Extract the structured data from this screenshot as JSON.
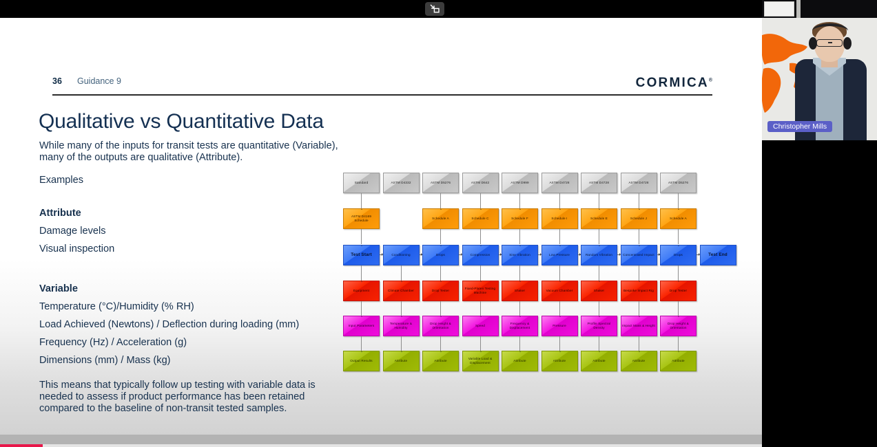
{
  "window": {
    "fullscreen_toggle_icon": "exit-fullscreen-icon"
  },
  "slide": {
    "page_number": "36",
    "section_label": "Guidance 9",
    "brand": "CORMICA",
    "brand_mark": "®",
    "title": "Qualitative vs Quantitative Data",
    "intro": "While many of the inputs for transit tests are quantitative (Variable), many of the outputs are qualitative (Attribute).",
    "examples_label": "Examples",
    "attribute_heading": "Attribute",
    "attribute_items": [
      "Damage levels",
      "Visual inspection"
    ],
    "variable_heading": "Variable",
    "variable_items": [
      "Temperature (°C)/Humidity (% RH)",
      "Load Achieved (Newtons) / Deflection during loading (mm)",
      "Frequency (Hz) / Acceleration (g)",
      "Dimensions (mm) / Mass (kg)"
    ],
    "closing": "This means that typically follow up testing with variable data is needed to assess if product performance has been retained compared to the baseline of non-transit tested samples."
  },
  "diagram": {
    "rows": [
      {
        "name": "standard-row",
        "color": "#c9c9c9",
        "cells": [
          "Standard",
          "ASTM D4332",
          "ASTM D5276",
          "ASTM D642",
          "ASTM D999",
          "ASTM D4728",
          "ASTM D4728",
          "ASTM D4728",
          "ASTM D5276",
          ""
        ]
      },
      {
        "name": "schedule-row",
        "color": "#ff9c0a",
        "cells": [
          "ASTM D4169 Schedule",
          "",
          "Schedule A",
          "Schedule C",
          "Schedule F",
          "Schedule I",
          "Schedule E",
          "Schedule J",
          "Schedule A",
          ""
        ]
      },
      {
        "name": "test-sequence-row",
        "color": "#2f6cf2",
        "cells": [
          "Test Start",
          "Conditioning",
          "Drops",
          "Compression",
          "Sine Vibration",
          "Low Pressure",
          "Random Vibration",
          "Concentrated Impact",
          "Drops",
          "Test End"
        ]
      },
      {
        "name": "equipment-row",
        "color": "#f72200",
        "cells": [
          "Equipment",
          "Climate Chamber",
          "Drop Tester",
          "Fixed-Platen Testing Machine",
          "Shaker",
          "Vacuum Chamber",
          "Shaker",
          "Bespoke Impact Rig",
          "Drop Tester",
          ""
        ]
      },
      {
        "name": "input-parameters-row",
        "color": "#ef0edc",
        "cells": [
          "Input Parameters",
          "Temperature & Humidity",
          "Drop Height & Orientation",
          "Speed",
          "Frequency & Displacement",
          "Pressure",
          "Profile Spectral Density",
          "Impact Mass & Height",
          "Drop Height & Orientation",
          ""
        ]
      },
      {
        "name": "output-results-row",
        "color": "#9fbb06",
        "cells": [
          "Output Results",
          "Attribute",
          "Attribute",
          "Variable Load & Displacement",
          "Attribute",
          "Attribute",
          "Attribute",
          "Attribute",
          "Attribute",
          ""
        ]
      }
    ]
  },
  "video": {
    "participant_name": "Christopher Mills"
  }
}
